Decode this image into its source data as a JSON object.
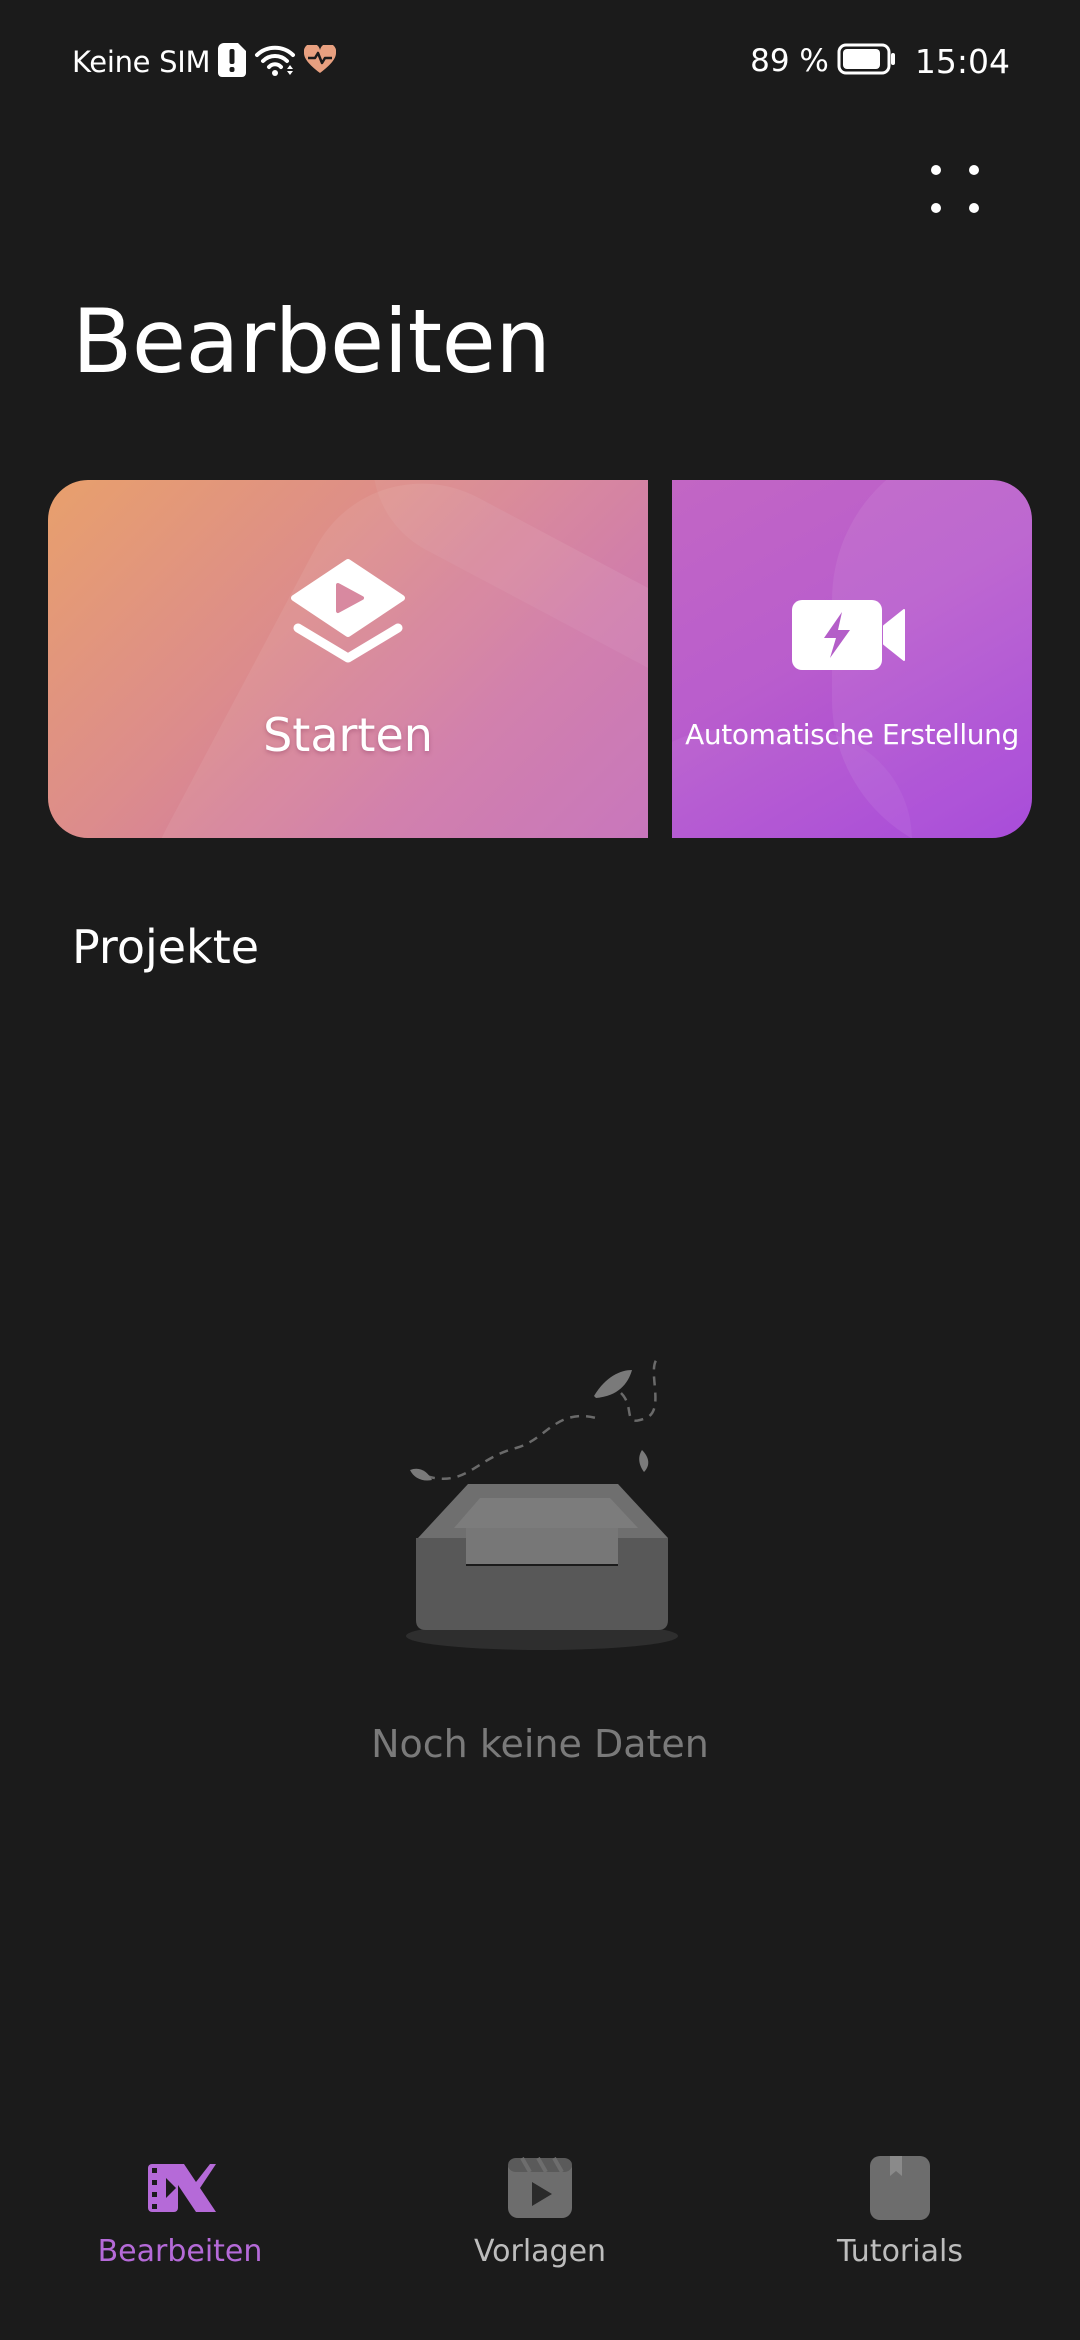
{
  "status_bar": {
    "carrier": "Keine SIM",
    "battery_percent": "89 %",
    "battery_level": 0.89,
    "time": "15:04"
  },
  "header": {
    "title": "Bearbeiten"
  },
  "cards": {
    "start_label": "Starten",
    "auto_label": "Automatische Erstellung"
  },
  "projects": {
    "section_title": "Projekte",
    "empty_text": "Noch keine Daten"
  },
  "bottom_nav": {
    "items": [
      {
        "label": "Bearbeiten",
        "icon": "edit-logo-icon",
        "active": true
      },
      {
        "label": "Vorlagen",
        "icon": "template-play-icon",
        "active": false
      },
      {
        "label": "Tutorials",
        "icon": "book-icon",
        "active": false
      }
    ]
  },
  "colors": {
    "background": "#1b1b1b",
    "accent": "#b56ad8",
    "start_gradient": [
      "#e8a06c",
      "#c46cb8"
    ],
    "auto_gradient": [
      "#c266c4",
      "#a23fd8"
    ],
    "muted_text": "#7a7a7a"
  }
}
